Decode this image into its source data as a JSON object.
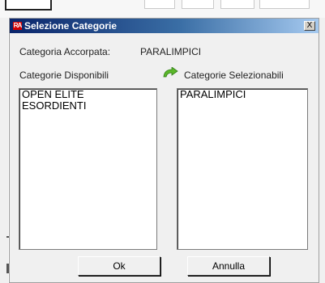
{
  "dialog": {
    "title": "Selezione Categorie",
    "app_icon_text": "RA",
    "close_label": "X",
    "accorpata_label": "Categoria Accorpata:",
    "accorpata_value": "PARALIMPICI",
    "disponibili_label": "Categorie Disponibili",
    "selezionabili_label": "Categorie Selezionabili",
    "disponibili_items": [
      "OPEN ELITE",
      "ESORDIENTI"
    ],
    "selezionabili_items": [
      "PARALIMPICI"
    ],
    "ok_label": "Ok",
    "annulla_label": "Annulla",
    "arrow_icon": "green-curved-arrow-icon",
    "title_color": "#0a246a"
  }
}
